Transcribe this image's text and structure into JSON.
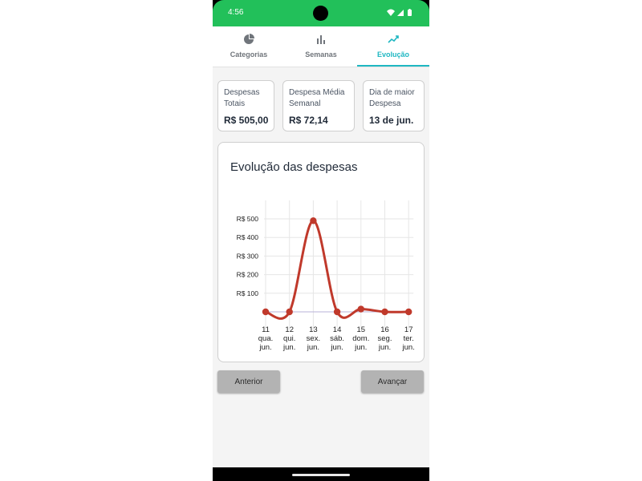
{
  "status_bar": {
    "time": "4:56"
  },
  "tabs": [
    {
      "label": "Categorias",
      "icon": "pie-chart-icon",
      "active": false
    },
    {
      "label": "Semanas",
      "icon": "bar-chart-icon",
      "active": false
    },
    {
      "label": "Evolução",
      "icon": "trending-line-icon",
      "active": true
    }
  ],
  "summary": {
    "total": {
      "label": "Despesas Totais",
      "value": "R$ 505,00"
    },
    "weekly_avg": {
      "label": "Despesa Média Semanal",
      "value": "R$ 72,14"
    },
    "max_day": {
      "label": "Dia de maior Despesa",
      "value": "13 de jun."
    }
  },
  "chart": {
    "title": "Evolução das despesas"
  },
  "chart_data": {
    "type": "line",
    "title": "Evolução das despesas",
    "x": [
      [
        "11",
        "qua.",
        "jun."
      ],
      [
        "12",
        "qui.",
        "jun."
      ],
      [
        "13",
        "sex.",
        "jun."
      ],
      [
        "14",
        "sáb.",
        "jun."
      ],
      [
        "15",
        "dom.",
        "jun."
      ],
      [
        "16",
        "seg.",
        "jun."
      ],
      [
        "17",
        "ter.",
        "jun."
      ]
    ],
    "values": [
      0,
      0,
      490,
      0,
      15,
      0,
      0
    ],
    "y_ticks": [
      "R$ 100",
      "R$ 200",
      "R$ 300",
      "R$ 400",
      "R$ 500"
    ],
    "ylim": [
      0,
      500
    ],
    "grid": true,
    "smooth": true,
    "line_color": "#c0392b",
    "point_color": "#c0392b"
  },
  "buttons": {
    "previous": "Anterior",
    "next": "Avançar"
  },
  "colors": {
    "status_bar": "#22c05a",
    "accent": "#1fb7c2",
    "line": "#c0392b",
    "button_bg": "#b3b3b3"
  }
}
